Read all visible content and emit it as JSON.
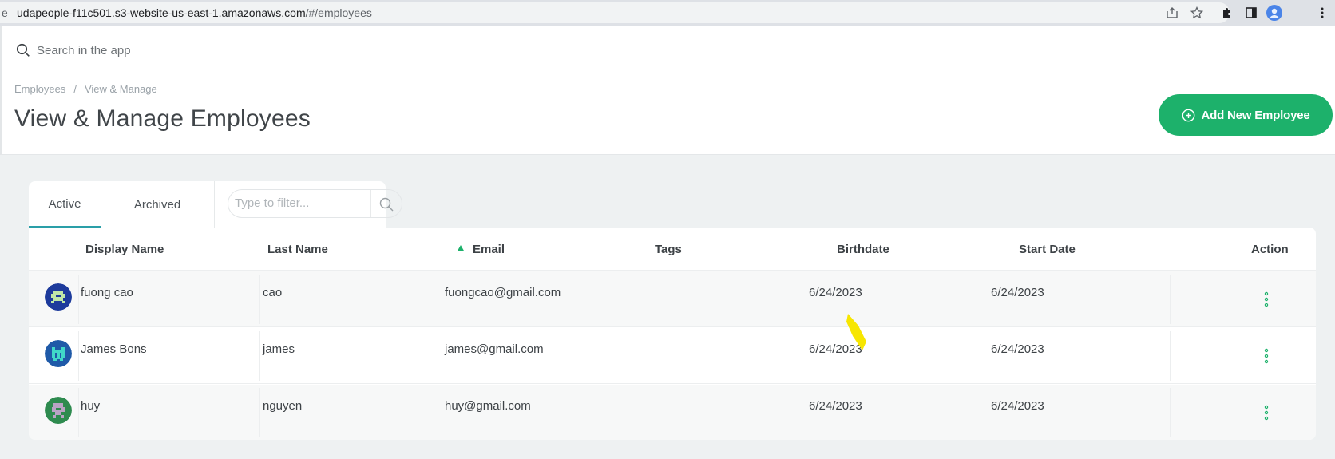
{
  "browser": {
    "url_host": "udapeople-f11c501.s3-website-us-east-1.amazonaws.com",
    "url_path": "/#/employees",
    "left_edge_char": "e"
  },
  "app": {
    "search": {
      "placeholder": "Search in the app"
    },
    "breadcrumb": {
      "items": [
        "Employees",
        "View & Manage"
      ],
      "separator": "/"
    },
    "page_title": "View & Manage Employees",
    "add_button_label": "Add New Employee",
    "tabs": [
      {
        "label": "Active",
        "active": true
      },
      {
        "label": "Archived",
        "active": false
      }
    ],
    "filter": {
      "placeholder": "Type to filter..."
    },
    "table": {
      "columns": [
        "Display Name",
        "Last Name",
        "Email",
        "Tags",
        "Birthdate",
        "Start Date",
        "Action"
      ],
      "sorted_column": "Email",
      "sort_direction": "ascending",
      "rows": [
        {
          "display_name": "fuong cao",
          "last_name": "cao",
          "email": "fuongcao@gmail.com",
          "tags": "",
          "birthdate": "6/24/2023",
          "start_date": "6/24/2023",
          "avatar_color": "#1d3b9c"
        },
        {
          "display_name": "James Bons",
          "last_name": "james",
          "email": "james@gmail.com",
          "tags": "",
          "birthdate": "6/24/2023",
          "start_date": "6/24/2023",
          "avatar_color": "#1f5aa8"
        },
        {
          "display_name": "huy",
          "last_name": "nguyen",
          "email": "huy@gmail.com",
          "tags": "",
          "birthdate": "6/24/2023",
          "start_date": "6/24/2023",
          "avatar_color": "#2e8b4f"
        }
      ]
    }
  },
  "colors": {
    "accent_green": "#1db16b",
    "tab_underline": "#2a9fa8",
    "kebab_green": "#1db16b",
    "highlight_yellow": "#f7e600"
  }
}
